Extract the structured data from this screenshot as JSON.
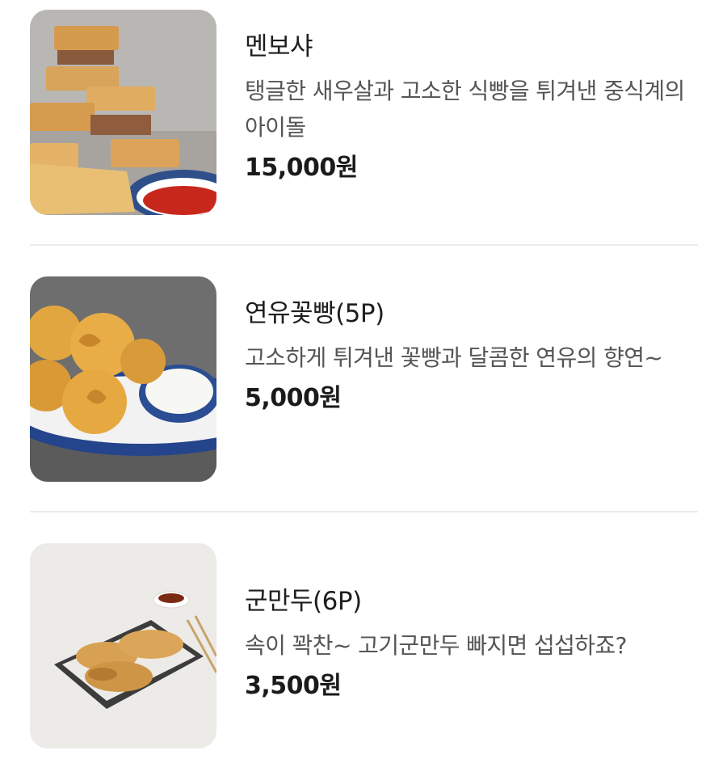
{
  "items": [
    {
      "name": "멘보샤",
      "description": "탱글한 새우살과 고소한 식빵을 튀겨낸 중식계의 아이돌",
      "price": "15,000원",
      "image_icon": "menbosha-photo"
    },
    {
      "name": "연유꽃빵(5P)",
      "description": "고소하게 튀겨낸 꽃빵과 달콤한 연유의 향연~",
      "price": "5,000원",
      "image_icon": "flower-bun-photo"
    },
    {
      "name": "군만두(6P)",
      "description": "속이 꽉찬~ 고기군만두 빠지면 섭섭하죠?",
      "price": "3,500원",
      "image_icon": "fried-dumpling-photo"
    }
  ],
  "colors": {
    "text_primary": "#1e1e1e",
    "text_secondary": "#555555",
    "divider": "#ececec"
  }
}
